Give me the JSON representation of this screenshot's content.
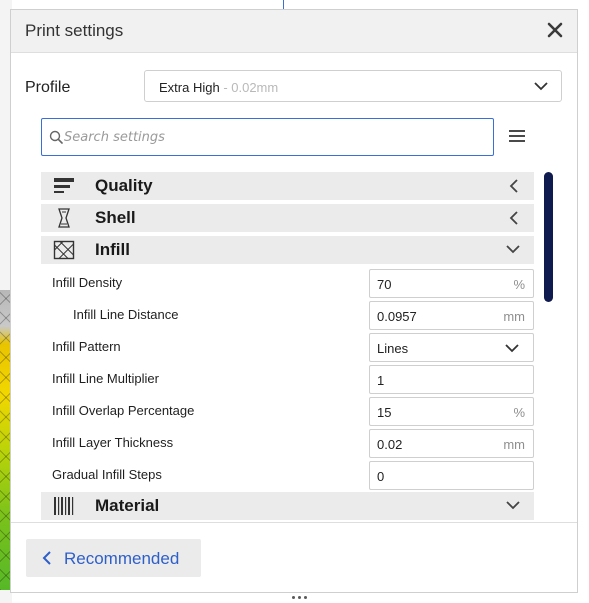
{
  "window": {
    "title": "Print settings"
  },
  "profile": {
    "label": "Profile",
    "name": "Extra High",
    "detail": " - 0.02mm"
  },
  "search": {
    "placeholder": "Search settings",
    "value": ""
  },
  "categories": [
    {
      "title": "Quality",
      "icon": "quality-icon",
      "state": "collapsed"
    },
    {
      "title": "Shell",
      "icon": "shell-icon",
      "state": "collapsed"
    },
    {
      "title": "Infill",
      "icon": "infill-icon",
      "state": "expanded"
    },
    {
      "title": "Material",
      "icon": "material-icon",
      "state": "expanded"
    }
  ],
  "infill_settings": [
    {
      "label": "Infill Density",
      "value": "70",
      "unit": "%",
      "indent": false,
      "type": "number"
    },
    {
      "label": "Infill Line Distance",
      "value": "0.0957",
      "unit": "mm",
      "indent": true,
      "type": "number"
    },
    {
      "label": "Infill Pattern",
      "value": "Lines",
      "unit": "",
      "indent": false,
      "type": "dropdown"
    },
    {
      "label": "Infill Line Multiplier",
      "value": "1",
      "unit": "",
      "indent": false,
      "type": "number"
    },
    {
      "label": "Infill Overlap Percentage",
      "value": "15",
      "unit": "%",
      "indent": false,
      "type": "number"
    },
    {
      "label": "Infill Layer Thickness",
      "value": "0.02",
      "unit": "mm",
      "indent": false,
      "type": "number"
    },
    {
      "label": "Gradual Infill Steps",
      "value": "0",
      "unit": "",
      "indent": false,
      "type": "number"
    }
  ],
  "footer": {
    "recommended_label": "Recommended"
  },
  "colors": {
    "accent": "#2e5fc9",
    "scrollbar": "#0f1b4f",
    "header_bg": "#f1f1f1",
    "category_bg": "#ebebeb"
  }
}
